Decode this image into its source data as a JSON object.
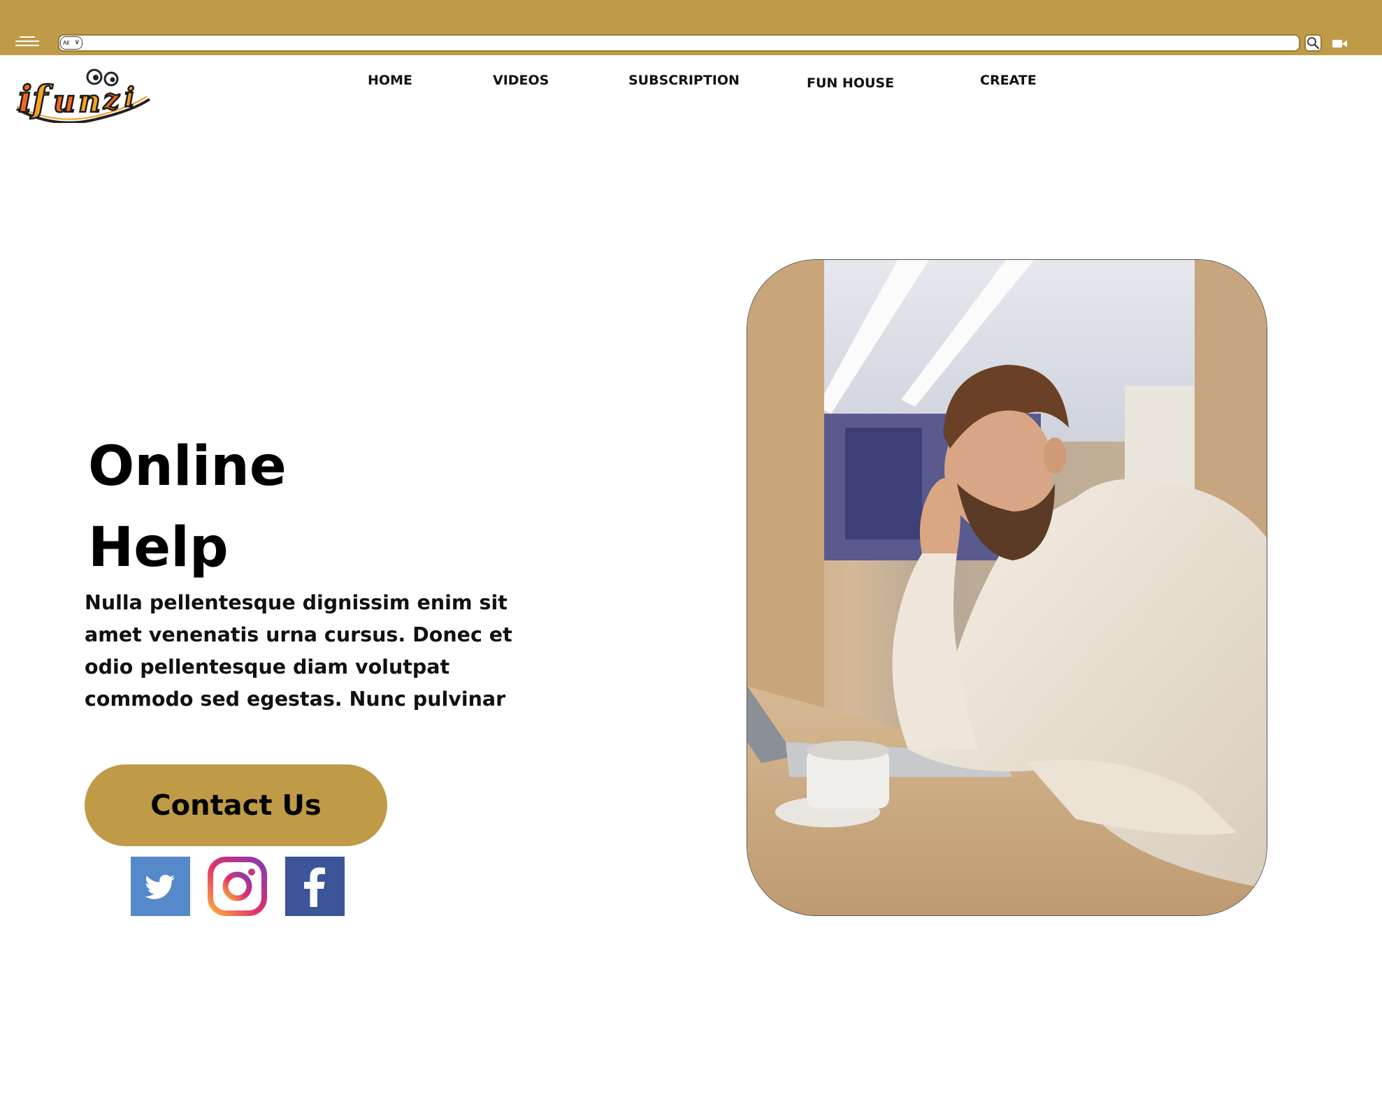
{
  "topbar": {
    "search_scope": "All",
    "search_placeholder": "",
    "colors": {
      "accent": "#bf9b48"
    }
  },
  "header": {
    "nav": [
      {
        "label": "HOME"
      },
      {
        "label": "VIDEOS"
      },
      {
        "label": "SUBSCRIPTION"
      },
      {
        "label": "FUN HOUSE"
      },
      {
        "label": "CREATE"
      }
    ]
  },
  "hero": {
    "title_line1": "Online",
    "title_line2": "Help",
    "body": "Nulla pellentesque dignissim enim sit amet venenatis urna cursus. Donec et odio pellentesque diam volutpat commodo sed egestas. Nunc pulvinar",
    "cta_label": "Contact Us"
  },
  "social": [
    {
      "icon": "twitter-icon",
      "color": "#5589c9"
    },
    {
      "icon": "instagram-icon",
      "color": "#e1306c"
    },
    {
      "icon": "facebook-icon",
      "color": "#3b5598"
    }
  ]
}
